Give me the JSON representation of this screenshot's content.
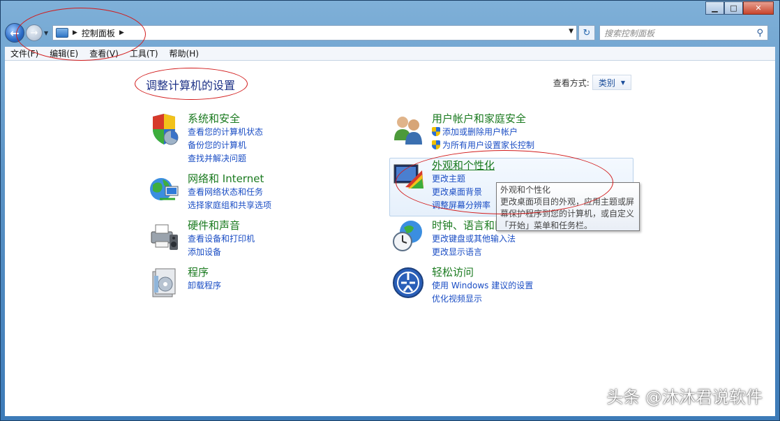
{
  "window": {
    "minimize": "▁",
    "maximize": "□",
    "close": "✕"
  },
  "nav": {
    "breadcrumb": [
      "控制面板"
    ],
    "search_placeholder": "搜索控制面板"
  },
  "menu": [
    "文件(F)",
    "编辑(E)",
    "查看(V)",
    "工具(T)",
    "帮助(H)"
  ],
  "main": {
    "title": "调整计算机的设置",
    "view_by_label": "查看方式:",
    "view_by_value": "类别"
  },
  "categories_left": [
    {
      "title": "系统和安全",
      "links": [
        "查看您的计算机状态",
        "备份您的计算机",
        "查找并解决问题"
      ]
    },
    {
      "title": "网络和 Internet",
      "links": [
        "查看网络状态和任务",
        "选择家庭组和共享选项"
      ]
    },
    {
      "title": "硬件和声音",
      "links": [
        "查看设备和打印机",
        "添加设备"
      ]
    },
    {
      "title": "程序",
      "links": [
        "卸载程序"
      ]
    }
  ],
  "categories_right": [
    {
      "title": "用户帐户和家庭安全",
      "links": [
        "添加或删除用户帐户",
        "为所有用户设置家长控制"
      ]
    },
    {
      "title": "外观和个性化",
      "links": [
        "更改主题",
        "更改桌面背景",
        "调整屏幕分辨率"
      ]
    },
    {
      "title": "时钟、语言和区域",
      "links": [
        "更改键盘或其他输入法",
        "更改显示语言"
      ]
    },
    {
      "title": "轻松访问",
      "links": [
        "使用 Windows 建议的设置",
        "优化视频显示"
      ]
    }
  ],
  "tooltip": {
    "title": "外观和个性化",
    "text": "更改桌面项目的外观，应用主题或屏幕保护程序到您的计算机，或自定义「开始」菜单和任务栏。"
  },
  "watermark": "头条 @沐沐君说软件",
  "colors": {
    "category_title": "#1a7a1f",
    "link": "#1a4dc4",
    "annotation": "#d21a1a"
  }
}
